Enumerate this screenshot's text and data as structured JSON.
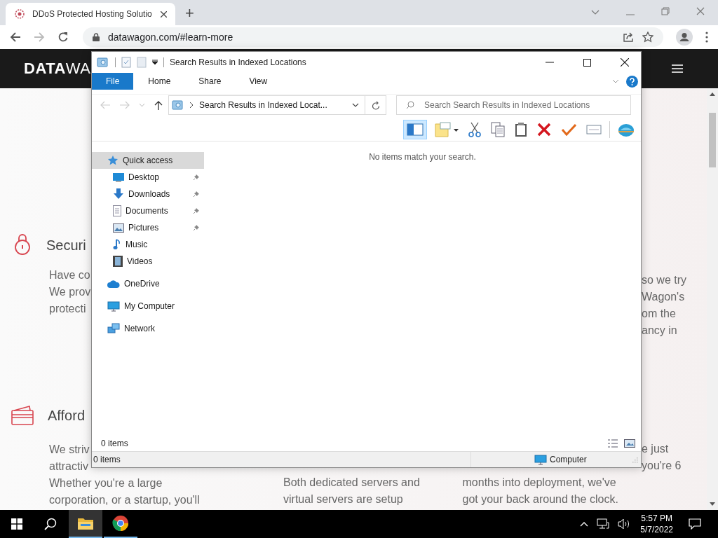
{
  "browser": {
    "tab_title": "DDoS Protected Hosting Solutio",
    "url": "datawagon.com/#learn-more",
    "new_tab": "+"
  },
  "site": {
    "logo_bold": "DATA",
    "logo_light": "WA",
    "left_features": [
      {
        "kind": "lock",
        "title": "Securi",
        "lines": [
          "Have co",
          "We prov",
          "protecti"
        ]
      },
      {
        "kind": "card",
        "title": "Afford",
        "lines": [
          "We striv",
          "attractiv",
          "Whether you're a large",
          "corporation, or a startup, you'll"
        ]
      }
    ],
    "right_upper_lines": [
      "so we try",
      "Wagon's",
      "om the",
      "ancy in"
    ],
    "right_lower_lines": [
      "e just",
      "you're 6"
    ],
    "middle_bottom_lines": [
      "Both dedicated servers and",
      "virtual servers are setup"
    ],
    "right_bottom_lines": [
      "months into deployment, we've",
      "got your back around the clock."
    ]
  },
  "explorer": {
    "title": "Search Results in Indexed Locations",
    "ribbon_tabs": [
      {
        "label": "File",
        "kind": "file"
      },
      {
        "label": "Home",
        "kind": "tab"
      },
      {
        "label": "Share",
        "kind": "tab"
      },
      {
        "label": "View",
        "kind": "tab"
      }
    ],
    "address": "Search Results in Indexed Locat...",
    "search": {
      "placeholder": "Search Search Results in Indexed Locations"
    },
    "nav": [
      {
        "label": "Quick access",
        "kind": "star",
        "selected": true,
        "children": [
          {
            "label": "Desktop",
            "kind": "desktop",
            "pinned": true,
            "selected": false
          },
          {
            "label": "Downloads",
            "kind": "download",
            "pinned": true,
            "selected": false
          },
          {
            "label": "Documents",
            "kind": "document",
            "pinned": true,
            "selected": false
          },
          {
            "label": "Pictures",
            "kind": "pictures",
            "pinned": true,
            "selected": false
          },
          {
            "label": "Music",
            "kind": "music",
            "pinned": false,
            "selected": false
          },
          {
            "label": "Videos",
            "kind": "videos",
            "pinned": false,
            "selected": false
          }
        ]
      },
      {
        "label": "OneDrive",
        "kind": "cloud",
        "selected": false
      },
      {
        "label": "My Computer",
        "kind": "computer",
        "selected": false
      },
      {
        "label": "Network",
        "kind": "network",
        "selected": false
      }
    ],
    "empty_message": "No items match your search.",
    "item_count": "0 items",
    "status_count": "0 items",
    "status_location": "Computer"
  },
  "taskbar": {
    "apps": [
      {
        "kind": "folder",
        "active": true
      },
      {
        "kind": "chrome",
        "active": false
      }
    ],
    "time": "5:57 PM",
    "date": "5/7/2022"
  }
}
